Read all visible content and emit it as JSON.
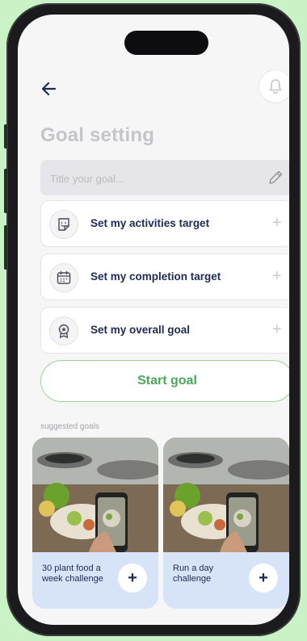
{
  "header": {
    "title": "Goal setting"
  },
  "goal_input": {
    "placeholder": "Title your goal..."
  },
  "options": [
    {
      "label": "Set my activities target"
    },
    {
      "label": "Set my completion target"
    },
    {
      "label": "Set my overall goal"
    }
  ],
  "start_button": {
    "label": "Start goal"
  },
  "suggested": {
    "heading": "suggested goals",
    "cards": [
      {
        "title": "30 plant food a week challenge"
      },
      {
        "title": "Run a day challenge"
      }
    ]
  },
  "colors": {
    "background": "#c9f3c6",
    "accent_green": "#4aa85a",
    "navy_text": "#1f2a55",
    "card_bg": "#d7e3f6"
  },
  "icons": [
    "back-arrow-icon",
    "bell-icon",
    "pencil-icon",
    "sticker-icon",
    "calendar-icon",
    "award-badge-icon",
    "plus-icon"
  ]
}
